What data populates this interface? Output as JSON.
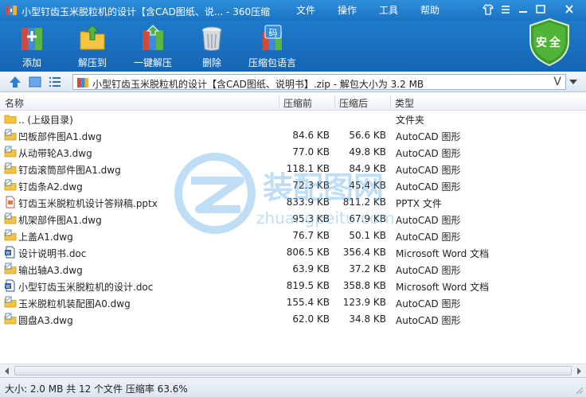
{
  "window": {
    "title": "小型钉齿玉米脱粒机的设计【含CAD图纸、说... - 360压缩",
    "menu": [
      "文件",
      "操作",
      "工具",
      "帮助"
    ]
  },
  "toolbar": {
    "buttons": [
      {
        "label": "添加",
        "icon": "add-books-icon"
      },
      {
        "label": "解压到",
        "icon": "extract-folder-icon"
      },
      {
        "label": "一键解压",
        "icon": "one-click-extract-icon"
      },
      {
        "label": "删除",
        "icon": "trash-can-icon"
      },
      {
        "label": "压缩包语言",
        "icon": "archive-language-icon"
      }
    ],
    "language_glyph": "码",
    "security_label": "安全"
  },
  "address": {
    "path": "小型钉齿玉米脱粒机的设计【含CAD图纸、说明书】.zip - 解包大小为 3.2 MB",
    "dropdown_glyph": "V"
  },
  "columns": {
    "name": "名称",
    "compressed": "压缩前",
    "uncompressed": "压缩后",
    "type": "类型"
  },
  "files": [
    {
      "name": ".. (上级目录)",
      "before": "",
      "after": "",
      "type": "文件夹",
      "icon": "folder"
    },
    {
      "name": "凹板部件图A1.dwg",
      "before": "84.6 KB",
      "after": "56.6 KB",
      "type": "AutoCAD 图形",
      "icon": "dwg"
    },
    {
      "name": "从动带轮A3.dwg",
      "before": "77.0 KB",
      "after": "49.8 KB",
      "type": "AutoCAD 图形",
      "icon": "dwg"
    },
    {
      "name": "钉齿滚筒部件图A1.dwg",
      "before": "118.1 KB",
      "after": "84.9 KB",
      "type": "AutoCAD 图形",
      "icon": "dwg"
    },
    {
      "name": "钉齿条A2.dwg",
      "before": "72.3 KB",
      "after": "45.4 KB",
      "type": "AutoCAD 图形",
      "icon": "dwg"
    },
    {
      "name": "钉齿玉米脱粒机设计答辩稿.pptx",
      "before": "833.9 KB",
      "after": "811.2 KB",
      "type": "PPTX 文件",
      "icon": "pptx"
    },
    {
      "name": "机架部件图A1.dwg",
      "before": "95.3 KB",
      "after": "67.9 KB",
      "type": "AutoCAD 图形",
      "icon": "dwg"
    },
    {
      "name": "上盖A1.dwg",
      "before": "76.7 KB",
      "after": "50.1 KB",
      "type": "AutoCAD 图形",
      "icon": "dwg"
    },
    {
      "name": "设计说明书.doc",
      "before": "806.5 KB",
      "after": "356.4 KB",
      "type": "Microsoft Word 文档",
      "icon": "doc"
    },
    {
      "name": "输出轴A3.dwg",
      "before": "63.9 KB",
      "after": "37.2 KB",
      "type": "AutoCAD 图形",
      "icon": "dwg"
    },
    {
      "name": "小型钉齿玉米脱粒机的设计.doc",
      "before": "819.5 KB",
      "after": "358.8 KB",
      "type": "Microsoft Word 文档",
      "icon": "doc"
    },
    {
      "name": "玉米脱粒机装配图A0.dwg",
      "before": "155.4 KB",
      "after": "123.9 KB",
      "type": "AutoCAD 图形",
      "icon": "dwg"
    },
    {
      "name": "圆盘A3.dwg",
      "before": "62.0 KB",
      "after": "34.8 KB",
      "type": "AutoCAD 图形",
      "icon": "dwg"
    }
  ],
  "watermark": {
    "text_cn": "装配图网",
    "text_en": "zhuangpeitu.com"
  },
  "status": {
    "text": "大小: 2.0 MB 共 12 个文件 压缩率 63.6%"
  },
  "colors": {
    "titlebar": "#1a73c3",
    "toolbar": "#1565b3",
    "shield": "#3f9a2b",
    "watermark": "#4aa3e6"
  }
}
